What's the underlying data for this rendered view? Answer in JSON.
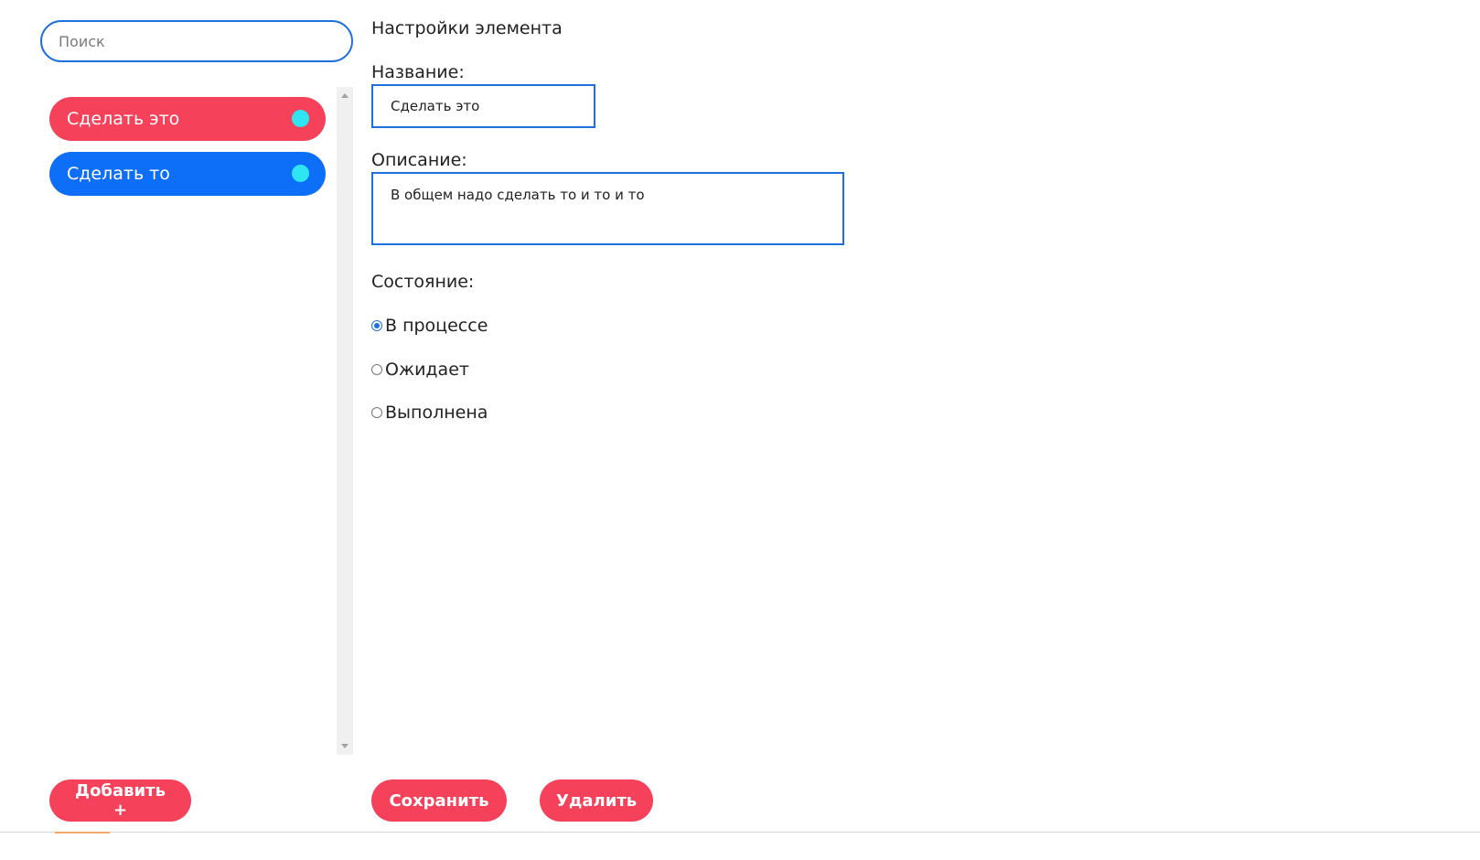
{
  "colors": {
    "accent_blue": "#1e6fe0",
    "brand_red": "#f5425a",
    "item_blue": "#0d6ef7",
    "status_dot": "#2de6f2",
    "scrollbar_track": "#f0f0f0"
  },
  "sidebar": {
    "search": {
      "placeholder": "Поиск",
      "value": ""
    },
    "items": [
      {
        "label": "Сделать это",
        "color": "#f5425a",
        "dot_color": "#2de6f2",
        "selected": true
      },
      {
        "label": "Сделать то",
        "color": "#0d6ef7",
        "dot_color": "#2de6f2",
        "selected": false
      }
    ],
    "add_button": "Добавить +"
  },
  "settings": {
    "title": "Настройки элемента",
    "name_label": "Название:",
    "name_value": "Сделать это",
    "description_label": "Описание:",
    "description_value": "В общем надо сделать то и то и то",
    "status_label": "Состояние:",
    "status_options": [
      {
        "label": "В процессе",
        "checked": true
      },
      {
        "label": "Ожидает",
        "checked": false
      },
      {
        "label": "Выполнена",
        "checked": false
      }
    ],
    "save_button": "Сохранить",
    "delete_button": "Удалить"
  }
}
